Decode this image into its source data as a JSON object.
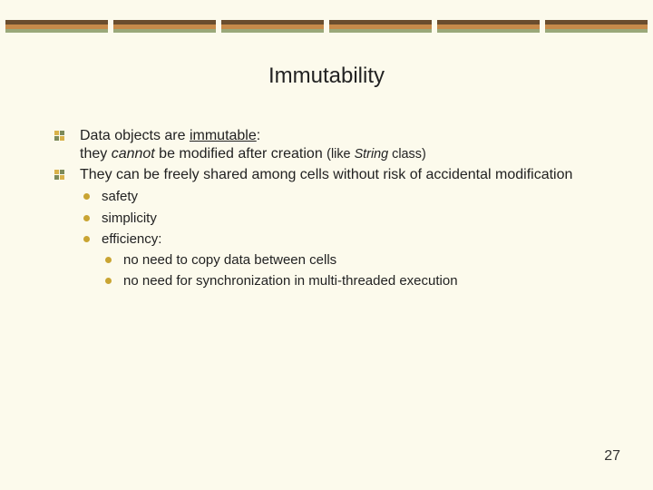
{
  "title": "Immutability",
  "bullets": {
    "b1": {
      "line1_prefix": "Data objects are ",
      "line1_immutable": "immutable",
      "line1_suffix": ":",
      "line2_prefix": "they ",
      "line2_cannot": "cannot",
      "line2_mid": " be modified after creation  ",
      "line2_note_open": "(like ",
      "line2_note_italic": "String",
      "line2_note_close": " class)"
    },
    "b2": "They can be freely shared among cells without risk of accidental modification",
    "sub": {
      "s1": "safety",
      "s2": "simplicity",
      "s3": "efficiency:",
      "s3a": "no need to copy data between cells",
      "s3b": "no need for synchronization in multi-threaded execution"
    }
  },
  "page_number": "27"
}
